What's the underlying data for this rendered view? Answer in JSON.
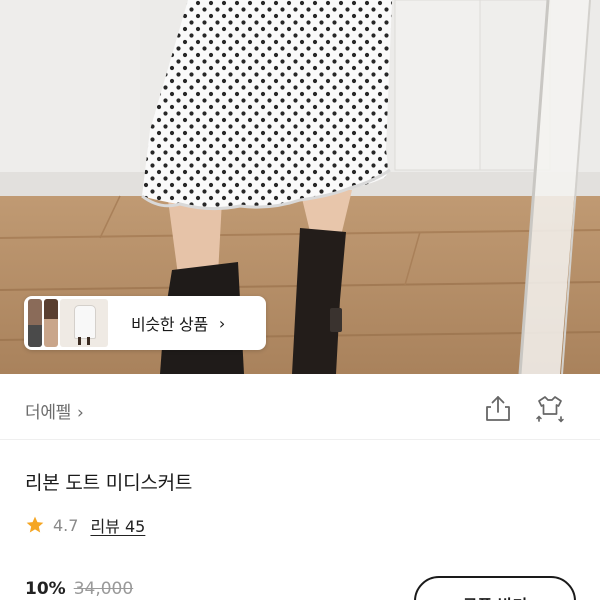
{
  "similar_products": {
    "label": "비슷한 상품",
    "chevron": "›"
  },
  "shop": {
    "name": "더에펠",
    "chevron": "›"
  },
  "actions": {
    "share_icon": "share-icon",
    "similar_icon": "similar-style-icon"
  },
  "product": {
    "title": "리본 도트 미디스커트",
    "rating": "4.7",
    "review_label": "리뷰 45",
    "discount": "10%",
    "original_price": "34,000"
  },
  "coupon_button": {
    "label": "쿠폰 받기"
  },
  "colors": {
    "star": "#f5a623",
    "text": "#1a1a1a",
    "muted": "#8a8a8a"
  }
}
